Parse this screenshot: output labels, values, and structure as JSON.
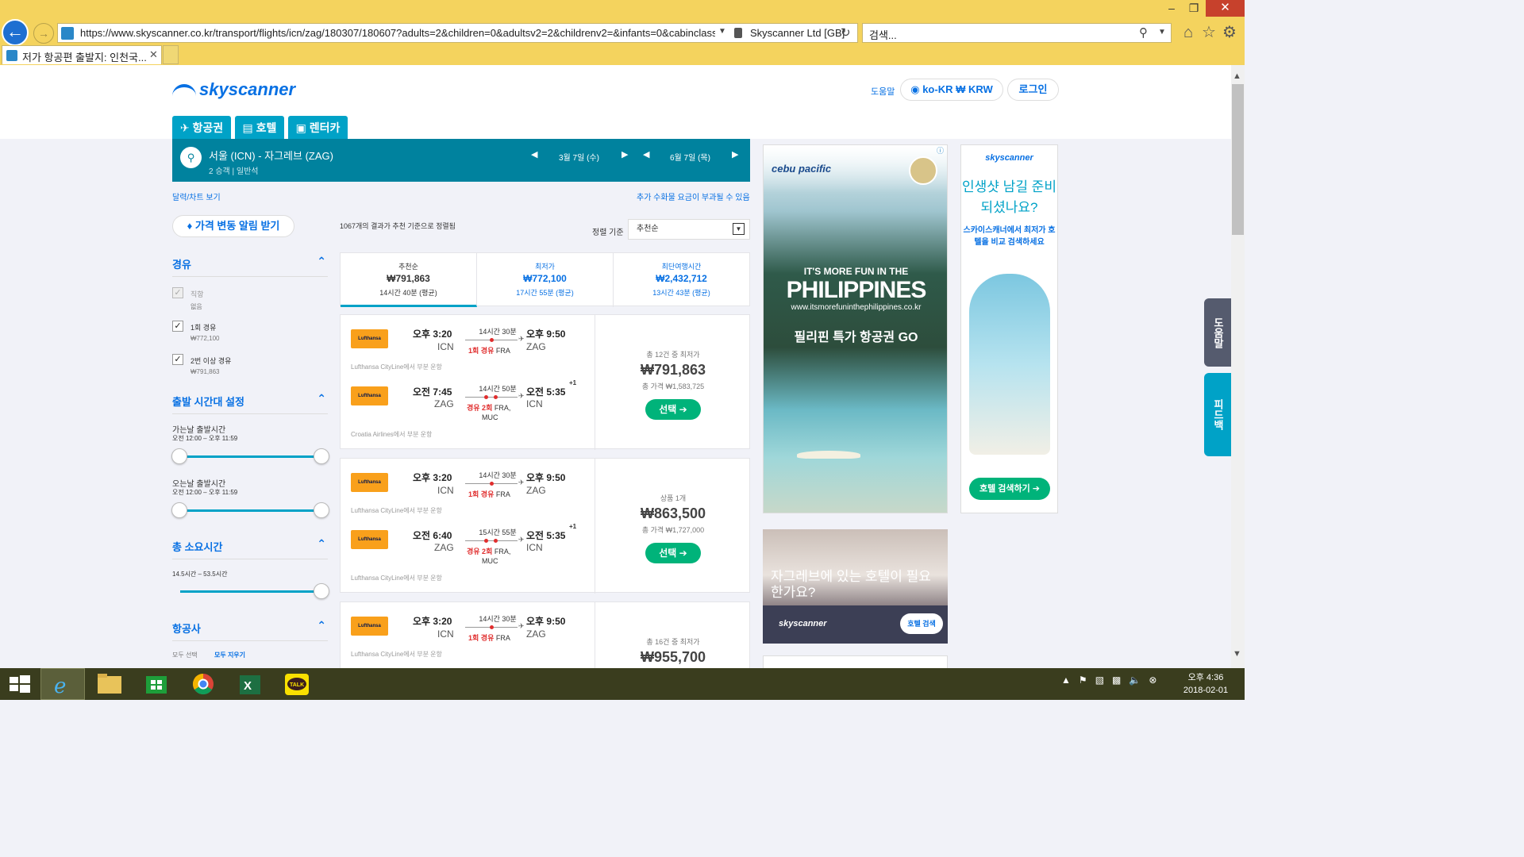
{
  "browser": {
    "url": "https://www.skyscanner.co.kr/transport/flights/icn/zag/180307/180607?adults=2&children=0&adultsv2=2&childrenv2=&infants=0&cabinclass=",
    "cert": "Skyscanner Ltd [GB]",
    "search_placeholder": "검색...",
    "tab_title": "저가 항공편 출발지: 인천국..."
  },
  "header": {
    "logo": "skyscanner",
    "help": "도움말",
    "locale": "ko-KR ₩ KRW",
    "login": "로그인",
    "tabs": [
      {
        "label": "항공권"
      },
      {
        "label": "호텔"
      },
      {
        "label": "렌터카"
      }
    ]
  },
  "searchbar": {
    "route": "서울 (ICN) - 자그레브 (ZAG)",
    "pax": "2 승객  |  일반석",
    "depart": "3월 7일 (수)",
    "return": "6월 7일 (목)"
  },
  "links": {
    "calendar": "달력/차트 보기",
    "fees": "추가 수화물 요금이 부과될 수 있음"
  },
  "alert_button": "가격 변동 알림 받기",
  "filters": {
    "stops_title": "경유",
    "stops": [
      {
        "label": "직항",
        "sub": "없음",
        "checked": false,
        "disabled": true
      },
      {
        "label": "1회 경유",
        "sub": "₩772,100",
        "checked": true
      },
      {
        "label": "2번 이상 경유",
        "sub": "₩791,863",
        "checked": true
      }
    ],
    "time_title": "출발 시간대 설정",
    "out_label": "가는날 출발시간",
    "out_range": "오전 12:00 – 오후 11:59",
    "in_label": "오는날 출발시간",
    "in_range": "오전 12:00 – 오후 11:59",
    "dur_title": "총 소요시간",
    "dur_range": "14.5시간 – 53.5시간",
    "airline_title": "항공사",
    "select_all": "모두 선택",
    "clear_all": "모두 지우기"
  },
  "results": {
    "count": "1067개의 결과가 추천 기준으로 정렬됨",
    "sort_label": "정렬 기준",
    "sort_value": "추천순",
    "sort_tabs": [
      {
        "title": "추천순",
        "price": "₩791,863",
        "sub": "14시간 40분 (평균)"
      },
      {
        "title": "최저가",
        "price": "₩772,100",
        "sub": "17시간 55분 (평균)"
      },
      {
        "title": "최단여행시간",
        "price": "₩2,432,712",
        "sub": "13시간 43분 (평균)"
      }
    ],
    "cards": [
      {
        "out": {
          "airline": "Lufthansa",
          "dep_time": "오후 3:20",
          "dep_ap": "ICN",
          "duration": "14시간 30분",
          "stops": "1회 경유",
          "via": "FRA",
          "arr_time": "오후 9:50",
          "arr_ap": "ZAG",
          "operator": "Lufthansa CityLine에서 부분 운항"
        },
        "ret": {
          "airline": "Lufthansa",
          "dep_time": "오전 7:45",
          "dep_ap": "ZAG",
          "duration": "14시간 50분",
          "stops": "경유 2회",
          "via": "FRA,",
          "via2": "MUC",
          "arr_time": "오전 5:35",
          "plus": "+1",
          "arr_ap": "ICN",
          "operator": "Croatia Airlines에서 부분 운항"
        },
        "price_note": "총 12건 중 최저가",
        "price": "₩791,863",
        "total": "총 가격 ₩1,583,725",
        "select": "선택 ➔"
      },
      {
        "out": {
          "airline": "Lufthansa",
          "dep_time": "오후 3:20",
          "dep_ap": "ICN",
          "duration": "14시간 30분",
          "stops": "1회 경유",
          "via": "FRA",
          "arr_time": "오후 9:50",
          "arr_ap": "ZAG",
          "operator": "Lufthansa CityLine에서 부분 운항"
        },
        "ret": {
          "airline": "Lufthansa",
          "dep_time": "오전 6:40",
          "dep_ap": "ZAG",
          "duration": "15시간 55분",
          "stops": "경유 2회",
          "via": "FRA,",
          "via2": "MUC",
          "arr_time": "오전 5:35",
          "plus": "+1",
          "arr_ap": "ICN",
          "operator": "Lufthansa CityLine에서 부분 운항"
        },
        "price_note": "상품 1개",
        "price": "₩863,500",
        "total": "총 가격 ₩1,727,000",
        "select": "선택 ➔"
      },
      {
        "out": {
          "airline": "Lufthansa",
          "dep_time": "오후 3:20",
          "dep_ap": "ICN",
          "duration": "14시간 30분",
          "stops": "1회 경유",
          "via": "FRA",
          "arr_time": "오후 9:50",
          "arr_ap": "ZAG",
          "operator": "Lufthansa CityLine에서 부분 운항"
        },
        "price_note": "총 16건 중 최저가",
        "price": "₩955,700"
      }
    ]
  },
  "ads": {
    "cebu": "cebu pacific",
    "fun": "IT'S MORE FUN IN THE",
    "philippines": "PHILIPPINES",
    "fun_url": "www.itsmorefuninthephilippines.co.kr",
    "deal": "필리핀 특가 항공권 GO",
    "sky_logo": "skyscanner",
    "sky_head": "인생샷 남길 준비되셨나요?",
    "sky_body": "스카이스캐너에서 최저가 호텔을 비교 검색하세요",
    "sky_btn": "호텔 검색하기 ➔",
    "hotel_q": "자그레브에 있는 호텔이 필요한가요?",
    "hotel_logo": "skyscanner",
    "hotel_btn": "호텔 검색"
  },
  "side": {
    "tab1": "도움말",
    "tab2": "피드백"
  },
  "taskbar": {
    "clock_time": "오후 4:36",
    "clock_date": "2018-02-01",
    "talk": "TALK"
  }
}
